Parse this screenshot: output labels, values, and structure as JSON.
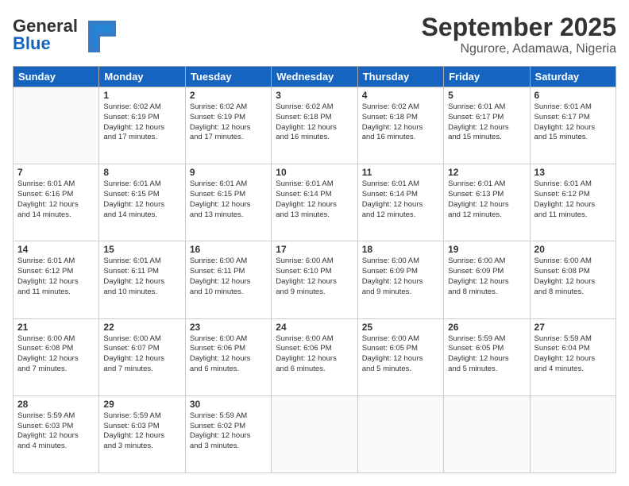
{
  "header": {
    "logo_general": "General",
    "logo_blue": "Blue",
    "month": "September 2025",
    "location": "Ngurore, Adamawa, Nigeria"
  },
  "weekdays": [
    "Sunday",
    "Monday",
    "Tuesday",
    "Wednesday",
    "Thursday",
    "Friday",
    "Saturday"
  ],
  "weeks": [
    [
      {
        "day": "",
        "info": ""
      },
      {
        "day": "1",
        "info": "Sunrise: 6:02 AM\nSunset: 6:19 PM\nDaylight: 12 hours\nand 17 minutes."
      },
      {
        "day": "2",
        "info": "Sunrise: 6:02 AM\nSunset: 6:19 PM\nDaylight: 12 hours\nand 17 minutes."
      },
      {
        "day": "3",
        "info": "Sunrise: 6:02 AM\nSunset: 6:18 PM\nDaylight: 12 hours\nand 16 minutes."
      },
      {
        "day": "4",
        "info": "Sunrise: 6:02 AM\nSunset: 6:18 PM\nDaylight: 12 hours\nand 16 minutes."
      },
      {
        "day": "5",
        "info": "Sunrise: 6:01 AM\nSunset: 6:17 PM\nDaylight: 12 hours\nand 15 minutes."
      },
      {
        "day": "6",
        "info": "Sunrise: 6:01 AM\nSunset: 6:17 PM\nDaylight: 12 hours\nand 15 minutes."
      }
    ],
    [
      {
        "day": "7",
        "info": "Sunrise: 6:01 AM\nSunset: 6:16 PM\nDaylight: 12 hours\nand 14 minutes."
      },
      {
        "day": "8",
        "info": "Sunrise: 6:01 AM\nSunset: 6:15 PM\nDaylight: 12 hours\nand 14 minutes."
      },
      {
        "day": "9",
        "info": "Sunrise: 6:01 AM\nSunset: 6:15 PM\nDaylight: 12 hours\nand 13 minutes."
      },
      {
        "day": "10",
        "info": "Sunrise: 6:01 AM\nSunset: 6:14 PM\nDaylight: 12 hours\nand 13 minutes."
      },
      {
        "day": "11",
        "info": "Sunrise: 6:01 AM\nSunset: 6:14 PM\nDaylight: 12 hours\nand 12 minutes."
      },
      {
        "day": "12",
        "info": "Sunrise: 6:01 AM\nSunset: 6:13 PM\nDaylight: 12 hours\nand 12 minutes."
      },
      {
        "day": "13",
        "info": "Sunrise: 6:01 AM\nSunset: 6:12 PM\nDaylight: 12 hours\nand 11 minutes."
      }
    ],
    [
      {
        "day": "14",
        "info": "Sunrise: 6:01 AM\nSunset: 6:12 PM\nDaylight: 12 hours\nand 11 minutes."
      },
      {
        "day": "15",
        "info": "Sunrise: 6:01 AM\nSunset: 6:11 PM\nDaylight: 12 hours\nand 10 minutes."
      },
      {
        "day": "16",
        "info": "Sunrise: 6:00 AM\nSunset: 6:11 PM\nDaylight: 12 hours\nand 10 minutes."
      },
      {
        "day": "17",
        "info": "Sunrise: 6:00 AM\nSunset: 6:10 PM\nDaylight: 12 hours\nand 9 minutes."
      },
      {
        "day": "18",
        "info": "Sunrise: 6:00 AM\nSunset: 6:09 PM\nDaylight: 12 hours\nand 9 minutes."
      },
      {
        "day": "19",
        "info": "Sunrise: 6:00 AM\nSunset: 6:09 PM\nDaylight: 12 hours\nand 8 minutes."
      },
      {
        "day": "20",
        "info": "Sunrise: 6:00 AM\nSunset: 6:08 PM\nDaylight: 12 hours\nand 8 minutes."
      }
    ],
    [
      {
        "day": "21",
        "info": "Sunrise: 6:00 AM\nSunset: 6:08 PM\nDaylight: 12 hours\nand 7 minutes."
      },
      {
        "day": "22",
        "info": "Sunrise: 6:00 AM\nSunset: 6:07 PM\nDaylight: 12 hours\nand 7 minutes."
      },
      {
        "day": "23",
        "info": "Sunrise: 6:00 AM\nSunset: 6:06 PM\nDaylight: 12 hours\nand 6 minutes."
      },
      {
        "day": "24",
        "info": "Sunrise: 6:00 AM\nSunset: 6:06 PM\nDaylight: 12 hours\nand 6 minutes."
      },
      {
        "day": "25",
        "info": "Sunrise: 6:00 AM\nSunset: 6:05 PM\nDaylight: 12 hours\nand 5 minutes."
      },
      {
        "day": "26",
        "info": "Sunrise: 5:59 AM\nSunset: 6:05 PM\nDaylight: 12 hours\nand 5 minutes."
      },
      {
        "day": "27",
        "info": "Sunrise: 5:59 AM\nSunset: 6:04 PM\nDaylight: 12 hours\nand 4 minutes."
      }
    ],
    [
      {
        "day": "28",
        "info": "Sunrise: 5:59 AM\nSunset: 6:03 PM\nDaylight: 12 hours\nand 4 minutes."
      },
      {
        "day": "29",
        "info": "Sunrise: 5:59 AM\nSunset: 6:03 PM\nDaylight: 12 hours\nand 3 minutes."
      },
      {
        "day": "30",
        "info": "Sunrise: 5:59 AM\nSunset: 6:02 PM\nDaylight: 12 hours\nand 3 minutes."
      },
      {
        "day": "",
        "info": ""
      },
      {
        "day": "",
        "info": ""
      },
      {
        "day": "",
        "info": ""
      },
      {
        "day": "",
        "info": ""
      }
    ]
  ]
}
